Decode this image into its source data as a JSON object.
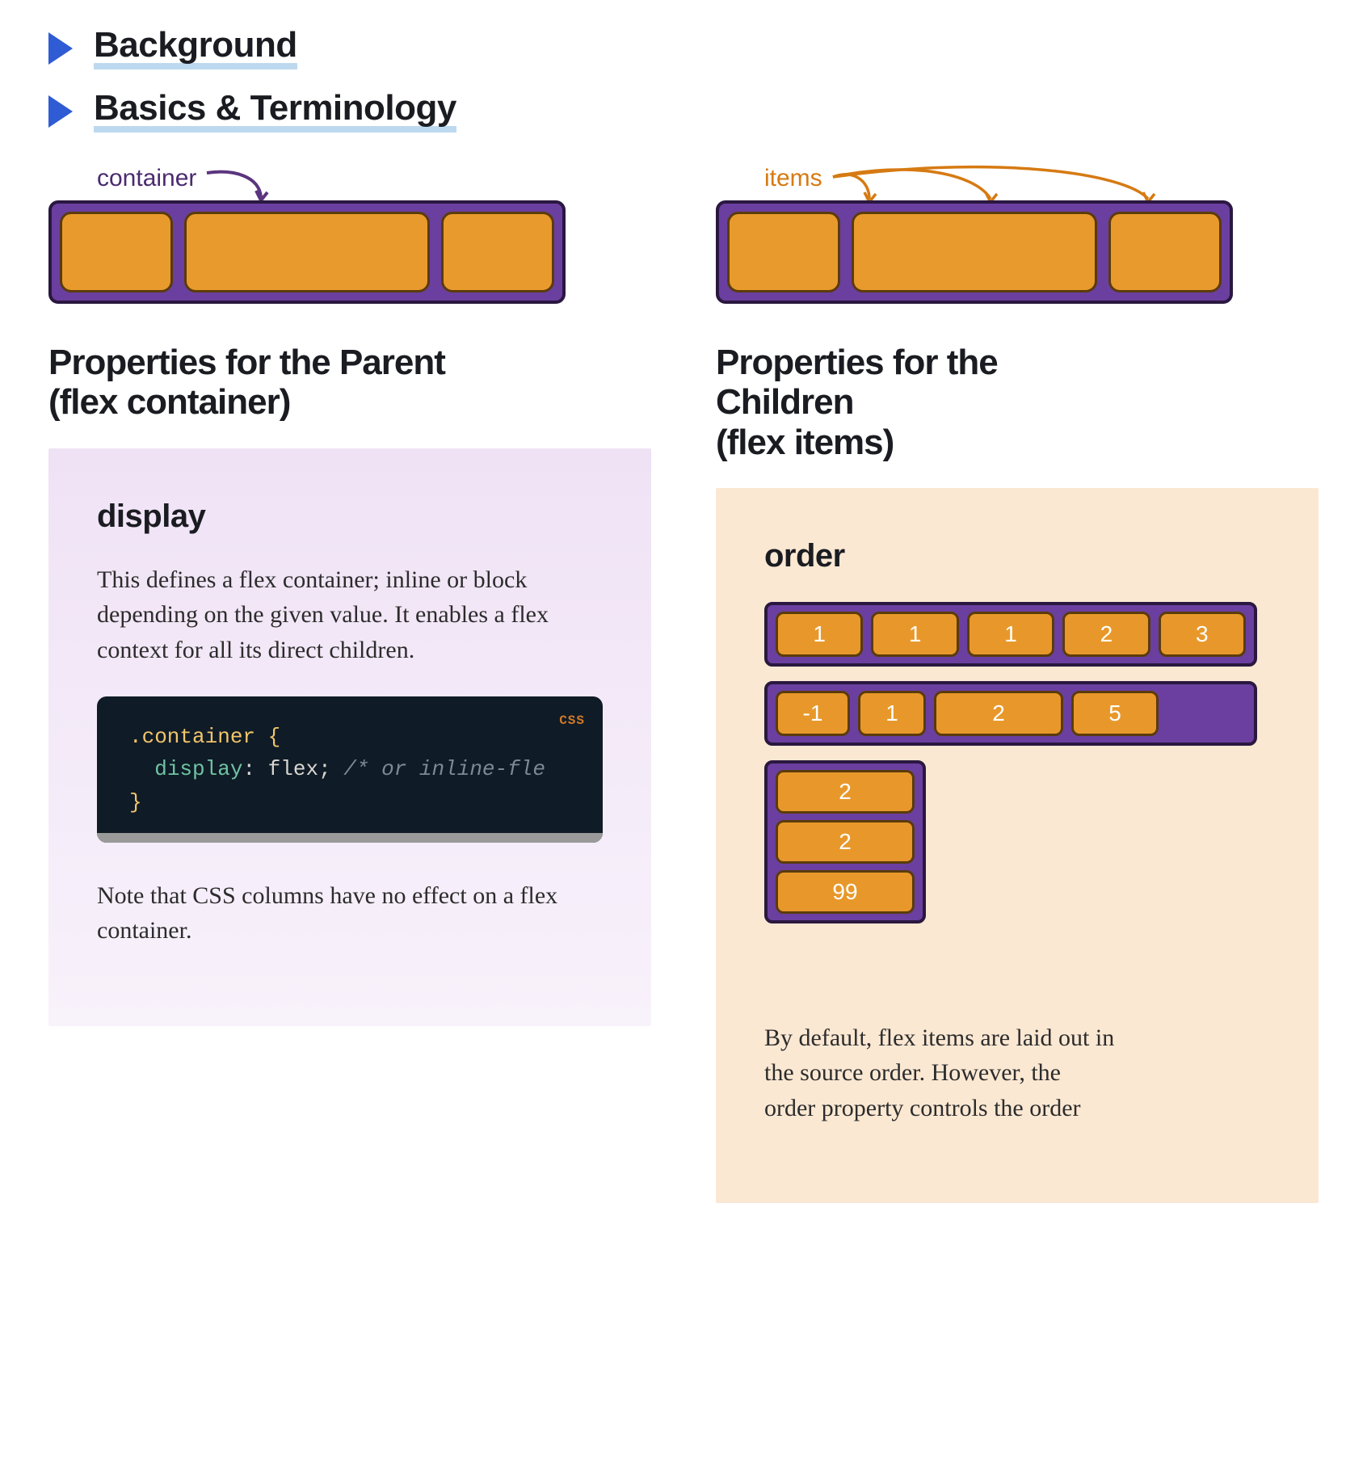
{
  "accordion": {
    "background": "Background",
    "basics": "Basics & Terminology"
  },
  "diagram": {
    "container_label": "container",
    "items_label": "items"
  },
  "parent": {
    "heading_l1": "Properties for the Parent",
    "heading_l2": "(flex container)",
    "display": {
      "title": "display",
      "intro": "This defines a flex container; inline or block depending on the given value. It enables a flex context for all its direct children.",
      "badge": "CSS",
      "code_selector": ".container",
      "code_brace_open": "{",
      "code_prop": "display",
      "code_colon": ":",
      "code_value": "flex",
      "code_semi": ";",
      "code_comment": "/* or inline-fle",
      "code_brace_close": "}",
      "note": "Note that CSS columns have no effect on a flex container."
    }
  },
  "children": {
    "heading_l1": "Properties for the",
    "heading_l2": "Children",
    "heading_l3": "(flex items)",
    "order": {
      "title": "order",
      "row1": [
        "1",
        "1",
        "1",
        "2",
        "3"
      ],
      "row2": [
        "-1",
        "1",
        "2",
        "5"
      ],
      "col": [
        "2",
        "2",
        "99"
      ],
      "desc_l1": "By default, flex items are laid out in",
      "desc_l2": "the source order. However, the",
      "desc_l3": " order  property controls the order"
    }
  }
}
